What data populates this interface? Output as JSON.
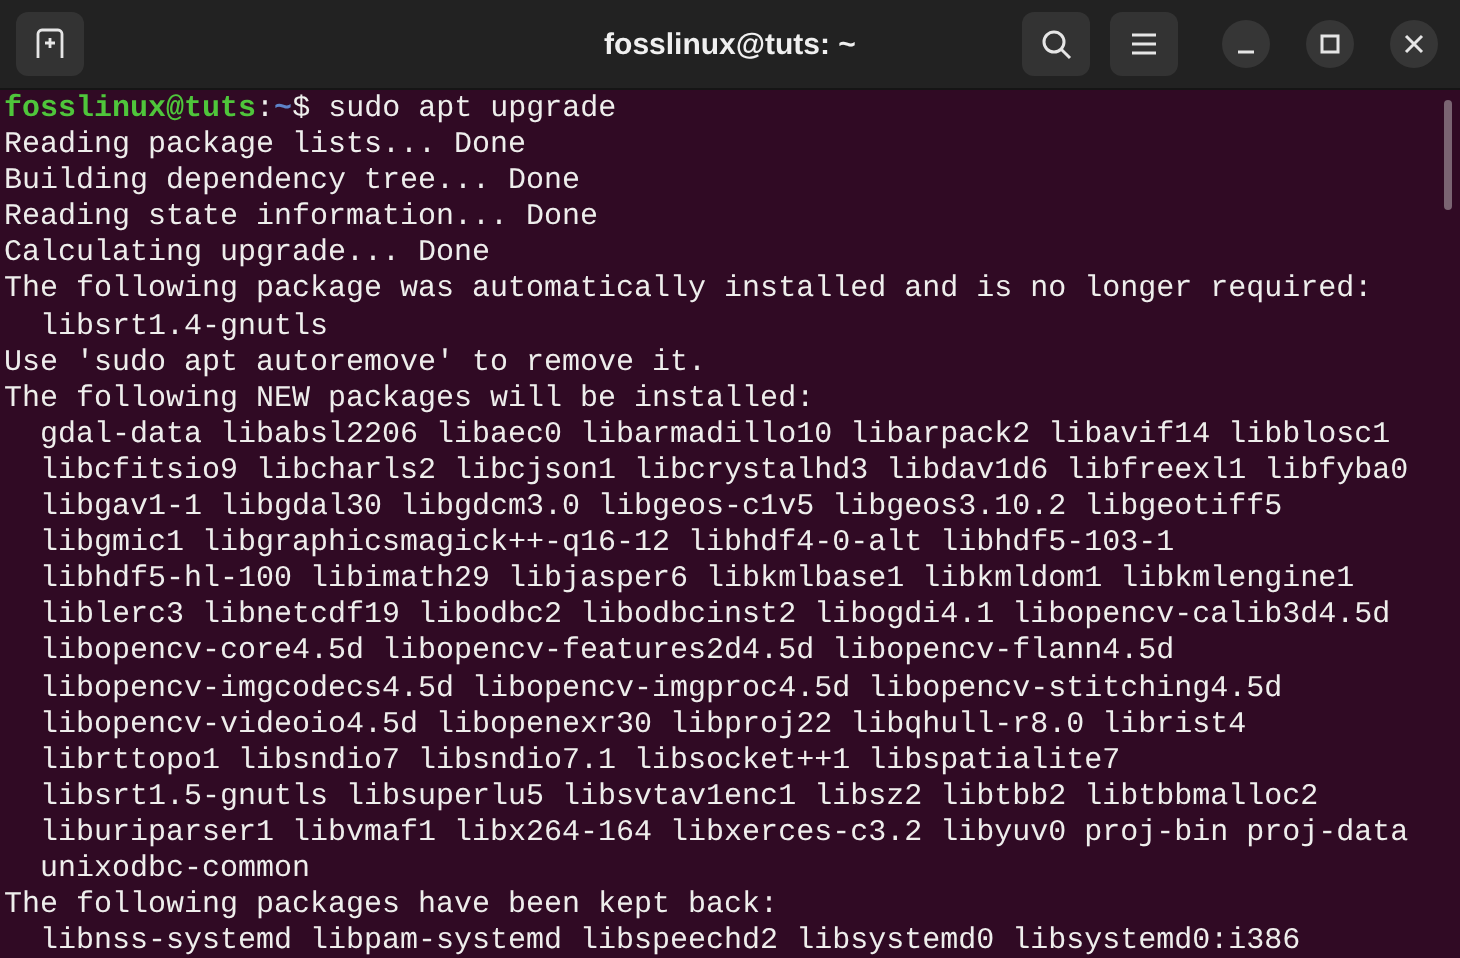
{
  "window": {
    "title": "fosslinux@tuts: ~"
  },
  "prompt": {
    "user_host": "fosslinux@tuts",
    "separator": ":",
    "path": "~",
    "symbol": "$",
    "command": "sudo apt upgrade"
  },
  "output_lines": [
    "Reading package lists... Done",
    "Building dependency tree... Done",
    "Reading state information... Done",
    "Calculating upgrade... Done",
    "The following package was automatically installed and is no longer required:",
    "  libsrt1.4-gnutls",
    "Use 'sudo apt autoremove' to remove it.",
    "The following NEW packages will be installed:",
    "  gdal-data libabsl2206 libaec0 libarmadillo10 libarpack2 libavif14 libblosc1",
    "  libcfitsio9 libcharls2 libcjson1 libcrystalhd3 libdav1d6 libfreexl1 libfyba0",
    "  libgav1-1 libgdal30 libgdcm3.0 libgeos-c1v5 libgeos3.10.2 libgeotiff5",
    "  libgmic1 libgraphicsmagick++-q16-12 libhdf4-0-alt libhdf5-103-1",
    "  libhdf5-hl-100 libimath29 libjasper6 libkmlbase1 libkmldom1 libkmlengine1",
    "  liblerc3 libnetcdf19 libodbc2 libodbcinst2 libogdi4.1 libopencv-calib3d4.5d",
    "  libopencv-core4.5d libopencv-features2d4.5d libopencv-flann4.5d",
    "  libopencv-imgcodecs4.5d libopencv-imgproc4.5d libopencv-stitching4.5d",
    "  libopencv-videoio4.5d libopenexr30 libproj22 libqhull-r8.0 librist4",
    "  librttopo1 libsndio7 libsndio7.1 libsocket++1 libspatialite7",
    "  libsrt1.5-gnutls libsuperlu5 libsvtav1enc1 libsz2 libtbb2 libtbbmalloc2",
    "  liburiparser1 libvmaf1 libx264-164 libxerces-c3.2 libyuv0 proj-bin proj-data",
    "  unixodbc-common",
    "The following packages have been kept back:",
    "  libnss-systemd libpam-systemd libspeechd2 libsystemd0 libsystemd0:i386"
  ]
}
